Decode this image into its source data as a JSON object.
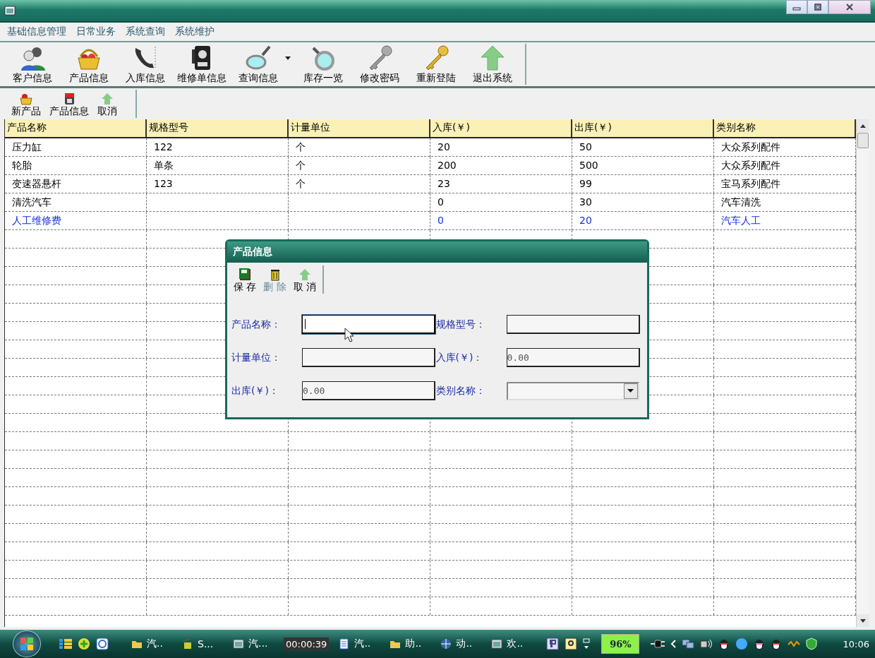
{
  "menu": [
    "基础信息管理",
    "日常业务",
    "系统查询",
    "系统维护"
  ],
  "toolbar": [
    {
      "label": "客户信息",
      "dropdown": false
    },
    {
      "label": "产品信息",
      "dropdown": false
    },
    {
      "label": "入库信息",
      "dropdown": false
    },
    {
      "label": "维修单信息",
      "dropdown": false
    },
    {
      "label": "查询信息",
      "dropdown": true
    },
    {
      "label": "库存一览",
      "dropdown": false
    },
    {
      "label": "修改密码",
      "dropdown": false
    },
    {
      "label": "重新登陆",
      "dropdown": false
    },
    {
      "label": "退出系统",
      "dropdown": false
    }
  ],
  "subtoolbar": [
    "新产品",
    "产品信息",
    "取消"
  ],
  "table": {
    "columns": [
      "产品名称",
      "规格型号",
      "计量单位",
      "入库(￥)",
      "出库(￥)",
      "类别名称"
    ],
    "rows": [
      {
        "highlighted": false,
        "cells": [
          "压力缸",
          "122",
          "个",
          "20",
          "50",
          "大众系列配件"
        ]
      },
      {
        "highlighted": false,
        "cells": [
          "轮胎",
          "单条",
          "个",
          "200",
          "500",
          "大众系列配件"
        ]
      },
      {
        "highlighted": false,
        "cells": [
          "变速器悬杆",
          "123",
          "个",
          "23",
          "99",
          "宝马系列配件"
        ]
      },
      {
        "highlighted": false,
        "cells": [
          "清洗汽车",
          "",
          "",
          "0",
          "30",
          "汽车清洗"
        ]
      },
      {
        "highlighted": true,
        "cells": [
          "人工维修费",
          "",
          "",
          "0",
          "20",
          "汽车人工"
        ]
      }
    ]
  },
  "dialog": {
    "title": "产品信息",
    "buttons": [
      {
        "label": "保 存",
        "disabled": false
      },
      {
        "label": "删 除",
        "disabled": true
      },
      {
        "label": "取 消",
        "disabled": false
      }
    ],
    "fields": [
      {
        "label": "产品名称：",
        "kind": "text",
        "focused": true
      },
      {
        "label": "规格型号：",
        "kind": "text",
        "focused": false
      },
      {
        "label": "计量单位：",
        "kind": "text",
        "focused": false
      },
      {
        "label": "入库(￥)：",
        "kind": "text",
        "value": "0.00",
        "focused": false
      },
      {
        "label": "出库(￥)：",
        "kind": "text",
        "value": "0.00",
        "focused": false
      },
      {
        "label": "类别名称：",
        "kind": "combo",
        "focused": false
      }
    ]
  },
  "taskbar": {
    "items": [
      "汽..",
      "S...",
      "汽...",
      "汽..",
      "助..",
      "动..",
      "欢.."
    ],
    "recorder_time": "00:00:39",
    "battery": "96%",
    "clock": "10:06"
  }
}
